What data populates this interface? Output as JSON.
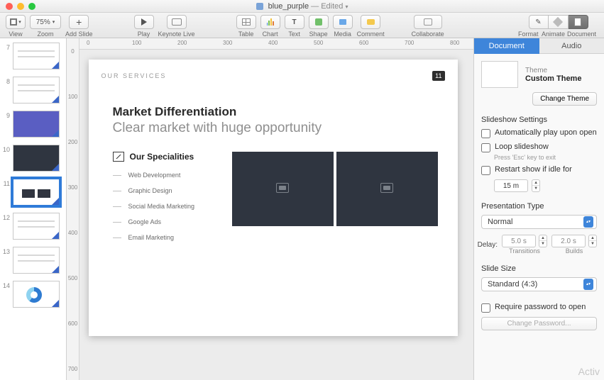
{
  "title": {
    "filename": "blue_purple",
    "status": "Edited"
  },
  "toolbar": {
    "view": "View",
    "zoom_label": "Zoom",
    "zoom_value": "75%",
    "add_slide": "Add Slide",
    "play": "Play",
    "keynote_live": "Keynote Live",
    "table": "Table",
    "chart": "Chart",
    "text": "Text",
    "shape": "Shape",
    "media": "Media",
    "comment": "Comment",
    "collaborate": "Collaborate",
    "format": "Format",
    "animate": "Animate",
    "document": "Document"
  },
  "ruler_h": [
    "0",
    "100",
    "200",
    "300",
    "400",
    "500",
    "600",
    "700",
    "800"
  ],
  "ruler_v": [
    "0",
    "100",
    "200",
    "300",
    "400",
    "500",
    "600",
    "700"
  ],
  "thumbs": [
    {
      "num": "7",
      "cls": "lines"
    },
    {
      "num": "8",
      "cls": "lines"
    },
    {
      "num": "9",
      "cls": "purple"
    },
    {
      "num": "10",
      "cls": "dark"
    },
    {
      "num": "11",
      "cls": "cboxes",
      "selected": true
    },
    {
      "num": "12",
      "cls": "lines"
    },
    {
      "num": "13",
      "cls": "lines"
    },
    {
      "num": "14",
      "cls": "donut"
    }
  ],
  "slide": {
    "kicker": "OUR SERVICES",
    "page": "11",
    "h2": "Market Differentiation",
    "h3": "Clear market with huge opportunity",
    "spec_head": "Our Specialities",
    "items": [
      "Web Development",
      "Graphic Design",
      "Social Media Marketing",
      "Google Ads",
      "Email Marketing"
    ]
  },
  "inspector": {
    "tabs": {
      "document": "Document",
      "audio": "Audio"
    },
    "theme_label": "Theme",
    "theme_name": "Custom Theme",
    "change_theme": "Change Theme",
    "slideshow_settings": "Slideshow Settings",
    "auto_play": "Automatically play upon open",
    "loop": "Loop slideshow",
    "loop_hint": "Press 'Esc' key to exit",
    "restart": "Restart show if idle for",
    "idle_value": "15 m",
    "presentation_type": "Presentation Type",
    "pt_value": "Normal",
    "delay_label": "Delay:",
    "transitions_val": "5.0 s",
    "transitions": "Transitions",
    "builds_val": "2.0 s",
    "builds": "Builds",
    "slide_size": "Slide Size",
    "size_value": "Standard (4:3)",
    "require_pw": "Require password to open",
    "change_pw": "Change Password..."
  },
  "watermark": "Activ"
}
